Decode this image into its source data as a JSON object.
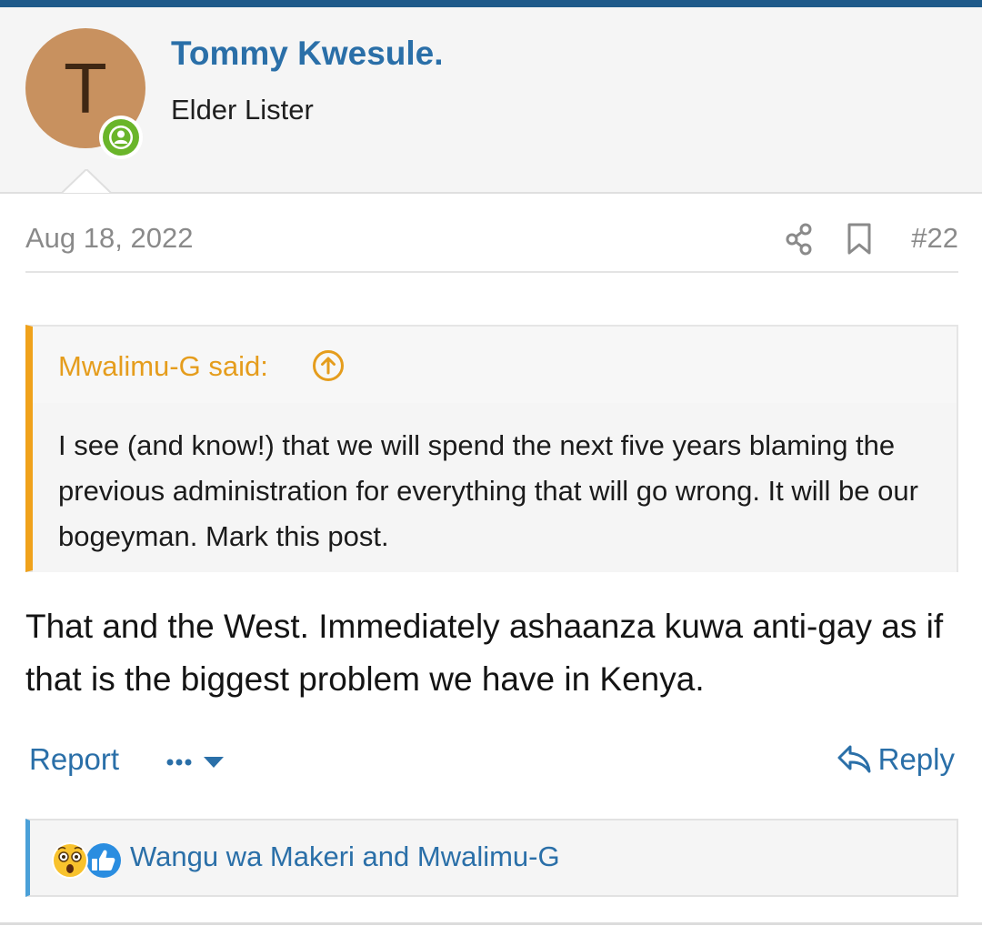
{
  "post": {
    "author": {
      "avatar_letter": "T",
      "name": "Tommy Kwesule.",
      "title": "Elder Lister",
      "avatar_color": "#c8915f",
      "online_color": "#6ab52a"
    },
    "date": "Aug 18, 2022",
    "number": "#22",
    "quote": {
      "author_label": "Mwalimu-G said:",
      "text": "I see (and know!) that we will spend the next five years blaming the previous administration for everything that will go wrong. It will be our bogeyman. Mark this post.",
      "accent_color": "#f0a21b"
    },
    "body": "That and the West. Immediately ashaanza kuwa anti-gay as if that is the biggest problem we have in Kenya.",
    "actions": {
      "report_label": "Report",
      "reply_label": "Reply"
    },
    "reactions": {
      "icons": [
        "astonished-emoji-icon",
        "thumbs-up-icon"
      ],
      "users_text": "Wangu wa Makeri and Mwalimu-G"
    }
  },
  "theme": {
    "link_color": "#2a6fa8",
    "top_bar_color": "#1e5a8a"
  }
}
